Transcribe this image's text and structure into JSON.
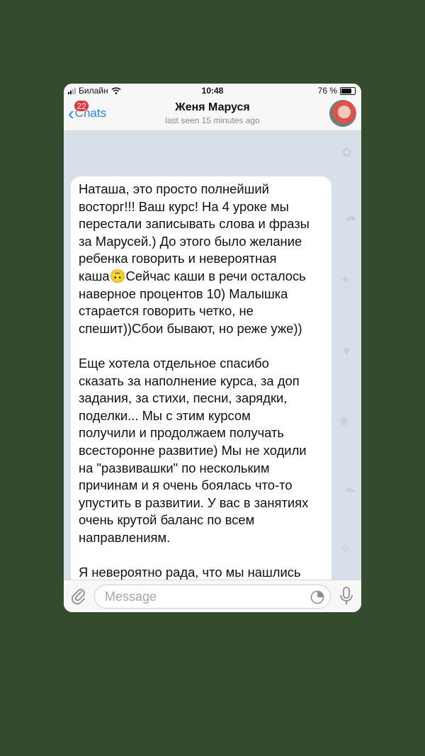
{
  "status_bar": {
    "carrier": "Билайн",
    "time": "10:48",
    "battery": "76 %"
  },
  "header": {
    "back_label": "Chats",
    "unread_count": "22",
    "contact_name": "Женя Маруся",
    "last_seen": "last seen 15 minutes ago"
  },
  "message": {
    "paragraphs": [
      "Наташа, это просто полнейший\nвосторг!!! Ваш курс! На 4 уроке мы\nперестали записывать слова и фразы\nза Марусей.) До этого было желание\nребенка говорить и невероятная\nкаша🙃Сейчас каши в речи осталось\nнаверное процентов 10) Малышка\nстарается говорить четко, не\nспешит))Сбои бывают, но реже уже))",
      "Еще хотела отдельное спасибо\nсказать за наполнение курса, за доп\nзадания, за стихи, песни, зарядки,\nподелки... Мы с этим курсом\nполучили и продолжаем получать\nвсесторонне развитие) Мы не ходили\nна \"развивашки\" по нескольким\nпричинам и я очень боялась что-то\nупустить в развитии. У вас в занятиях\nочень крутой баланс по всем\nнаправлениям.",
      "Я невероятно рада, что мы нашлись\n🤗🤗🤗 и Маруся тоже, так как\nпросит, включить ей нашу Нату😘😘\n😘"
    ]
  },
  "input": {
    "placeholder": "Message"
  },
  "colors": {
    "accent": "#2a84e6",
    "badge": "#e0343c",
    "page_background": "#344b2e"
  }
}
